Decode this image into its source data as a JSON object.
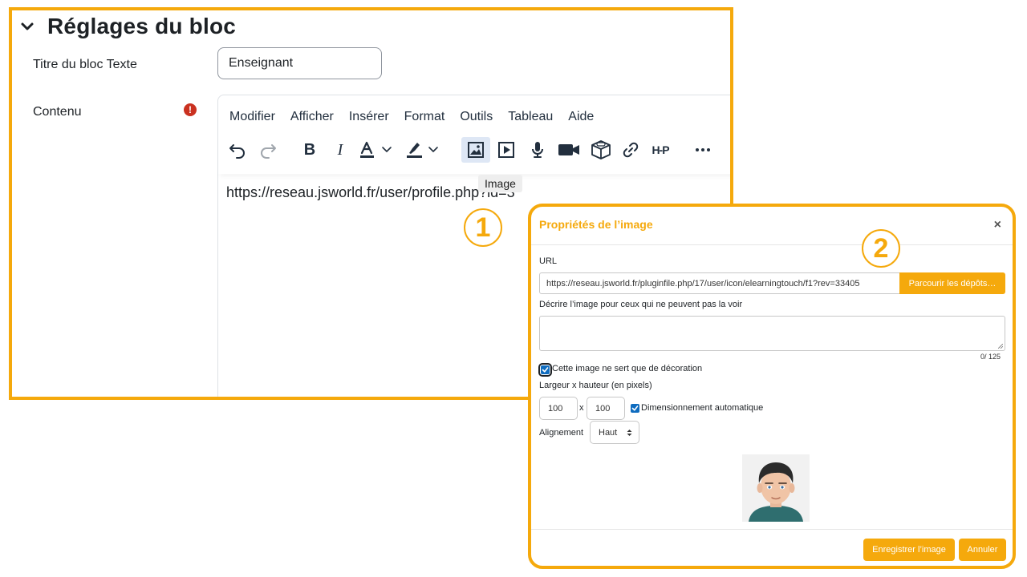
{
  "settings": {
    "section_title": "Réglages du bloc",
    "title_label": "Titre du bloc Texte",
    "title_value": "Enseignant",
    "content_label": "Contenu",
    "required_symbol": "!"
  },
  "editor": {
    "menu": [
      "Modifier",
      "Afficher",
      "Insérer",
      "Format",
      "Outils",
      "Tableau",
      "Aide"
    ],
    "toolbar_icons": [
      "undo-icon",
      "redo-icon",
      "bold-icon",
      "italic-icon",
      "text-color-icon",
      "highlight-icon",
      "image-icon",
      "media-icon",
      "microphone-icon",
      "video-camera-icon",
      "cube-icon",
      "link-icon",
      "h5p-icon",
      "more-icon"
    ],
    "bold_glyph": "B",
    "italic_glyph": "I",
    "h5p_label": "H-P",
    "tooltip": "Image",
    "content_text": "https://reseau.jsworld.fr/user/profile.php?id=3"
  },
  "markers": {
    "step1": "1",
    "step2": "2"
  },
  "dialog": {
    "title": "Propriétés de l’image",
    "close": "×",
    "url_label": "URL",
    "url_value": "https://reseau.jsworld.fr/pluginfile.php/17/user/icon/elearningtouch/f1?rev=33405",
    "browse_label": "Parcourir les dépôts…",
    "alt_label": "Décrire l’image pour ceux qui ne peuvent pas la voir",
    "char_count": "0/ 125",
    "decorative_label": "Cette image ne sert que de décoration",
    "decorative_checked": true,
    "size_label": "Largeur x hauteur (en pixels)",
    "width": "100",
    "size_separator": "x",
    "height": "100",
    "auto_size_label": "Dimensionnement automatique",
    "auto_size_checked": true,
    "align_label": "Alignement",
    "align_value": "Haut",
    "save_label": "Enregistrer l’image",
    "cancel_label": "Annuler"
  },
  "colors": {
    "accent": "#f5a90c",
    "checkbox": "#0f6cbf",
    "required": "#ca3120",
    "active_tool": "#dee7f5"
  }
}
